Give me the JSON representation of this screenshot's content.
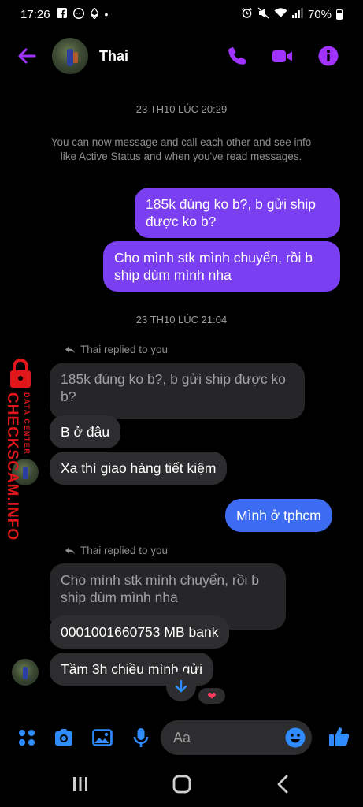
{
  "status_bar": {
    "time": "17:26",
    "battery": "70%"
  },
  "header": {
    "contact_name": "Thai"
  },
  "chat": {
    "timestamp_1": "23 TH10 LÚC 20:29",
    "system_message": "You can now message and call each other and see info like Active Status and when you've read messages.",
    "out_1": "185k đúng ko b?, b gửi ship được ko b?",
    "out_2": "Cho mình stk mình chuyển, rồi b ship dùm mình nha",
    "timestamp_2": "23 TH10 LÚC 21:04",
    "reply_label_1": "Thai replied to you",
    "quoted_1": "185k đúng ko b?, b gửi ship được ko b?",
    "in_1": "B ở đâu",
    "in_2": "Xa thì giao hàng tiết kiệm",
    "out_3": "Mình ở tphcm",
    "reply_label_2": "Thai replied to you",
    "quoted_2": "Cho mình stk mình chuyển, rồi b ship dùm mình nha",
    "in_3": "0001001660753 MB bank",
    "in_4": "Tầm 3h chiều mình gửi",
    "reaction": "❤"
  },
  "watermark": {
    "main": "CHECKSCAM.INFO",
    "sub": "DATA CENTER"
  },
  "composer": {
    "placeholder": "Aa"
  },
  "colors": {
    "accent": "#a033ff",
    "outgoing_bubble": "#7b3ff2",
    "outgoing_blue": "#3b6cf2",
    "incoming_bubble": "#2d2d2f",
    "composer_icons": "#2f8cff",
    "watermark": "#e0161b"
  },
  "icons": {
    "header": [
      "back-arrow-icon",
      "phone-icon",
      "video-camera-icon",
      "info-icon"
    ],
    "composer": [
      "apps-grid-icon",
      "camera-icon",
      "gallery-icon",
      "microphone-icon",
      "emoji-icon",
      "thumbs-up-icon"
    ],
    "nav": [
      "recents-icon",
      "home-icon",
      "back-icon"
    ]
  }
}
